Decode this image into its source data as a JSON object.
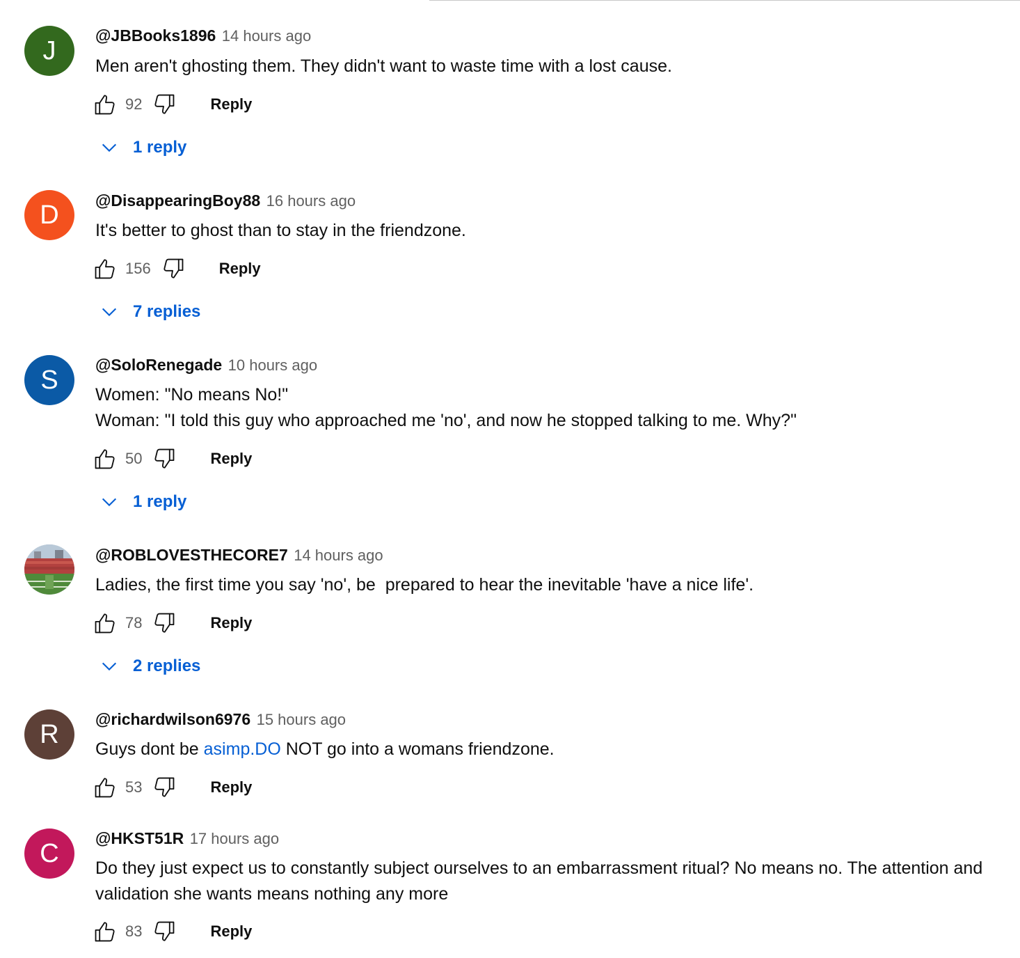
{
  "comments": [
    {
      "avatar_letter": "J",
      "avatar_color": "#33691e",
      "author": "@JBBooks1896",
      "time": "14 hours ago",
      "lines": [
        "Men aren't ghosting them. They didn't want to waste time with a lost cause."
      ],
      "likes": "92",
      "reply_label": "Reply",
      "replies_label": "1 reply"
    },
    {
      "avatar_letter": "D",
      "avatar_color": "#f4511e",
      "author": "@DisappearingBoy88",
      "time": "16 hours ago",
      "lines": [
        "It's better to ghost than to stay in the friendzone."
      ],
      "likes": "156",
      "reply_label": "Reply",
      "replies_label": "7 replies"
    },
    {
      "avatar_letter": "S",
      "avatar_color": "#0b5aa6",
      "author": "@SoloRenegade",
      "time": "10 hours ago",
      "lines": [
        "Women: \"No means No!\"",
        "Woman: \"I told this guy who approached me 'no', and now he stopped talking to me. Why?\""
      ],
      "likes": "50",
      "reply_label": "Reply",
      "replies_label": "1 reply"
    },
    {
      "avatar_image": "stadium-photo",
      "author": "@ROBLOVESTHECORE7",
      "time": "14 hours ago",
      "lines": [
        "Ladies, the first time you say 'no', be  prepared to hear the inevitable 'have a nice life'."
      ],
      "likes": "78",
      "reply_label": "Reply",
      "replies_label": "2 replies"
    },
    {
      "avatar_letter": "R",
      "avatar_color": "#5d4037",
      "author": "@richardwilson6976",
      "time": "15 hours ago",
      "text_before": "Guys dont be ",
      "link_text": "asimp.DO",
      "text_after": " NOT go into a womans friendzone.",
      "likes": "53",
      "reply_label": "Reply"
    },
    {
      "avatar_letter": "C",
      "avatar_color": "#c2185b",
      "author": "@HKST51R",
      "time": "17 hours ago",
      "lines": [
        "Do they just expect us to constantly subject ourselves to an embarrassment ritual? No means no. The attention and validation she wants means nothing any more"
      ],
      "likes": "83",
      "reply_label": "Reply"
    }
  ],
  "icons": {
    "like": "thumbs-up-icon",
    "dislike": "thumbs-down-icon",
    "expand": "chevron-down-icon"
  },
  "colors": {
    "link": "#065fd4",
    "meta": "#606060"
  }
}
